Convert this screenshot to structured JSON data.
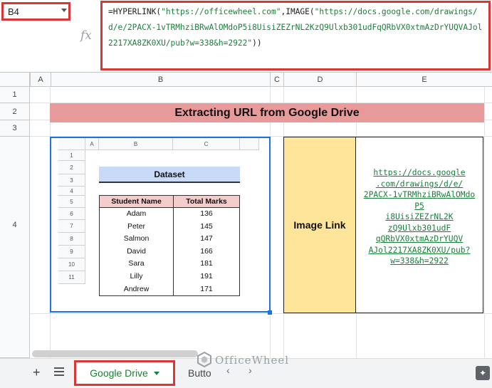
{
  "name_box": "B4",
  "fx_label": "fx",
  "formula": {
    "parts": [
      {
        "t": "=HYPERLINK(",
        "cls": ""
      },
      {
        "t": "\"https://officewheel.com\"",
        "cls": "str"
      },
      {
        "t": ",IMAGE(",
        "cls": ""
      },
      {
        "t": "\"https://docs.google.com/drawings/d/e/2PACX-1vTRMhziBRwAlOMdoP5i8UisiZEZrNL2KzQ9Ulxb301udFqQRbVX0xtmAzDrYUQVAJol2217XA8ZK0XU/pub?w=338&h=2922\"",
        "cls": "str"
      },
      {
        "t": "))",
        "cls": ""
      }
    ]
  },
  "columns": [
    "A",
    "B",
    "C",
    "D",
    "E"
  ],
  "rows": [
    "1",
    "2",
    "3",
    "4"
  ],
  "title": "Extracting URL from Google Drive",
  "embedded": {
    "columns": [
      "A",
      "B",
      "C"
    ],
    "rows": [
      "1",
      "2",
      "3",
      "4",
      "5",
      "6",
      "7",
      "8",
      "9",
      "10",
      "11"
    ],
    "heading": "Dataset",
    "headers": [
      "Student Name",
      "Total Marks"
    ],
    "records": [
      [
        "Adam",
        "136"
      ],
      [
        "Peter",
        "145"
      ],
      [
        "Salmon",
        "147"
      ],
      [
        "David",
        "166"
      ],
      [
        "Sara",
        "181"
      ],
      [
        "Lilly",
        "191"
      ],
      [
        "Andrew",
        "171"
      ]
    ],
    "colors": {
      "heading_bg": "#c9daf8",
      "header_bg": "#f4cccc"
    }
  },
  "link_label": "Image Link",
  "link_lines": [
    "https://docs.google",
    ".com/drawings/d/e/",
    "2PACX-1vTRMhziBRwAlOMdo",
    "P5",
    "i8UisiZEZrNL2K",
    "zQ9Ulxb301udF",
    "qQRbVX0xtmAzDrYUQV",
    "AJol2217XA8ZK0XU/pub?",
    "w=338&h=2922"
  ],
  "tabs": {
    "active": "Google Drive",
    "next": "Butto"
  },
  "watermark": "OfficeWheel",
  "colors": {
    "selection": "#1a73e8",
    "highlight": "#d93636",
    "title_bg": "#e8999a",
    "label_bg": "#ffe599",
    "link": "#1b7f3b"
  }
}
